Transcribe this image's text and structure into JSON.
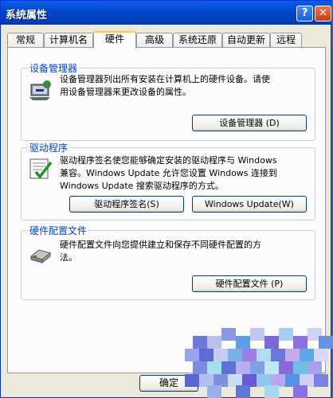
{
  "window": {
    "title": "系统属性",
    "help_label": "?",
    "close_label": "✕"
  },
  "tabs": [
    {
      "label": "常规"
    },
    {
      "label": "计算机名"
    },
    {
      "label": "硬件"
    },
    {
      "label": "高级"
    },
    {
      "label": "系统还原"
    },
    {
      "label": "自动更新"
    },
    {
      "label": "远程"
    }
  ],
  "device_manager": {
    "title": "设备管理器",
    "line1": "设备管理器列出所有安装在计算机上的硬件设备。请使",
    "line2": "用设备管理器来更改设备的属性。",
    "button": "设备管理器 (D)",
    "icon": "device-manager-icon"
  },
  "drivers": {
    "title": "驱动程序",
    "line1": "驱动程序签名使您能够确定安装的驱动程序与 Windows",
    "line2": "兼容。Windows Update 允许您设置 Windows 连接到",
    "line3": "Windows Update 搜索驱动程序的方式。",
    "signing_button": "驱动程序签名(S)",
    "update_button": "Windows Update(W)",
    "icon": "driver-signing-icon"
  },
  "profiles": {
    "title": "硬件配置文件",
    "line1": "硬件配置文件向您提供建立和保存不同硬件配置的方",
    "line2": "法。",
    "button": "硬件配置文件 (P)",
    "icon": "hardware-profile-icon"
  },
  "footer": {
    "ok_label": "确定"
  }
}
